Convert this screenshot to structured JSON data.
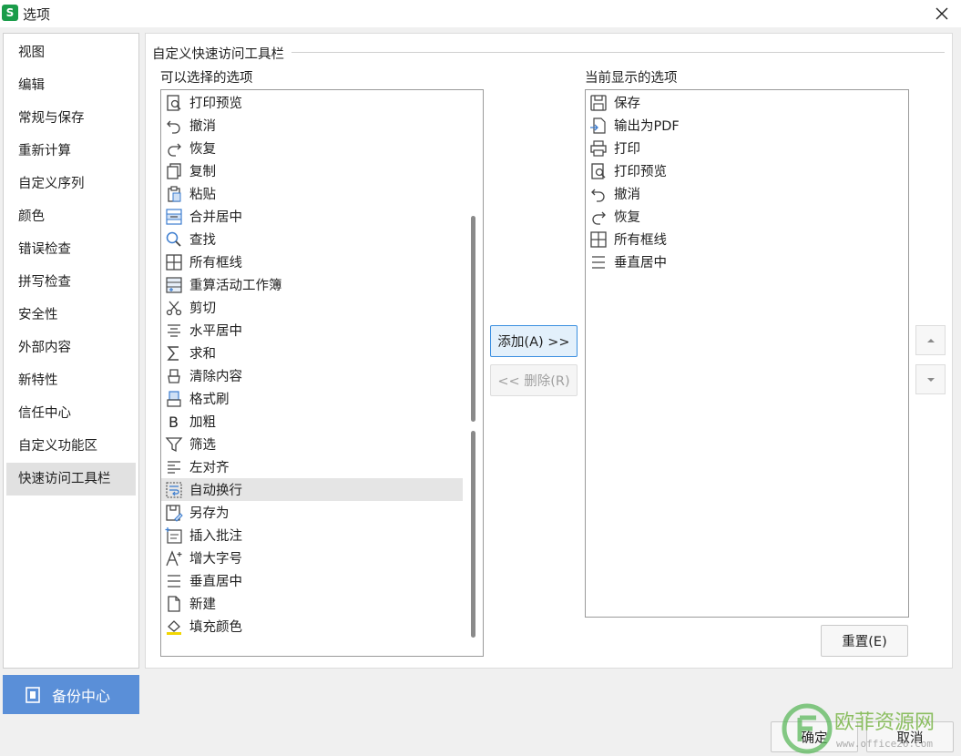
{
  "window": {
    "title": "选项",
    "logo_letter": "S"
  },
  "sidebar": {
    "items": [
      {
        "label": "视图"
      },
      {
        "label": "编辑"
      },
      {
        "label": "常规与保存"
      },
      {
        "label": "重新计算"
      },
      {
        "label": "自定义序列"
      },
      {
        "label": "颜色"
      },
      {
        "label": "错误检查"
      },
      {
        "label": "拼写检查"
      },
      {
        "label": "安全性"
      },
      {
        "label": "外部内容"
      },
      {
        "label": "新特性"
      },
      {
        "label": "信任中心"
      },
      {
        "label": "自定义功能区"
      },
      {
        "label": "快速访问工具栏"
      }
    ],
    "active_index": 13,
    "backup_label": "备份中心"
  },
  "main": {
    "group_title": "自定义快速访问工具栏",
    "available_label": "可以选择的选项",
    "current_label": "当前显示的选项",
    "available": [
      {
        "label": "打印预览",
        "icon": "print-preview-icon"
      },
      {
        "label": "撤消",
        "icon": "undo-icon"
      },
      {
        "label": "恢复",
        "icon": "redo-icon"
      },
      {
        "label": "复制",
        "icon": "copy-icon"
      },
      {
        "label": "粘贴",
        "icon": "paste-icon"
      },
      {
        "label": "合并居中",
        "icon": "merge-center-icon"
      },
      {
        "label": "查找",
        "icon": "search-icon"
      },
      {
        "label": "所有框线",
        "icon": "all-borders-icon"
      },
      {
        "label": "重算活动工作簿",
        "icon": "recalculate-icon"
      },
      {
        "label": "剪切",
        "icon": "cut-icon"
      },
      {
        "label": "水平居中",
        "icon": "align-center-icon"
      },
      {
        "label": "求和",
        "icon": "sum-icon"
      },
      {
        "label": "清除内容",
        "icon": "clear-content-icon"
      },
      {
        "label": "格式刷",
        "icon": "format-painter-icon"
      },
      {
        "label": "加粗",
        "icon": "bold-icon"
      },
      {
        "label": "筛选",
        "icon": "filter-icon"
      },
      {
        "label": "左对齐",
        "icon": "align-left-icon"
      },
      {
        "label": "自动换行",
        "icon": "wrap-text-icon"
      },
      {
        "label": "另存为",
        "icon": "save-as-icon"
      },
      {
        "label": "插入批注",
        "icon": "insert-comment-icon"
      },
      {
        "label": "增大字号",
        "icon": "increase-font-icon"
      },
      {
        "label": "垂直居中",
        "icon": "middle-align-icon"
      },
      {
        "label": "新建",
        "icon": "new-file-icon"
      },
      {
        "label": "填充颜色",
        "icon": "fill-color-icon"
      }
    ],
    "available_selected_index": 17,
    "current": [
      {
        "label": "保存",
        "icon": "save-icon"
      },
      {
        "label": "输出为PDF",
        "icon": "export-pdf-icon"
      },
      {
        "label": "打印",
        "icon": "print-icon"
      },
      {
        "label": "打印预览",
        "icon": "print-preview-icon"
      },
      {
        "label": "撤消",
        "icon": "undo-icon"
      },
      {
        "label": "恢复",
        "icon": "redo-icon"
      },
      {
        "label": "所有框线",
        "icon": "all-borders-icon"
      },
      {
        "label": "垂直居中",
        "icon": "middle-align-icon"
      }
    ],
    "add_label": "添加(A) >>",
    "remove_label": "<< 删除(R)",
    "reset_label": "重置(E)"
  },
  "footer": {
    "ok_label": "确定",
    "cancel_label": "取消"
  },
  "watermark": {
    "text_cn": "欧菲资源网",
    "text_url": "www.office26.com"
  },
  "colors": {
    "accent": "#5a8fd8",
    "selection": "#e5e5e5",
    "primary_border": "#3b8fe0"
  }
}
